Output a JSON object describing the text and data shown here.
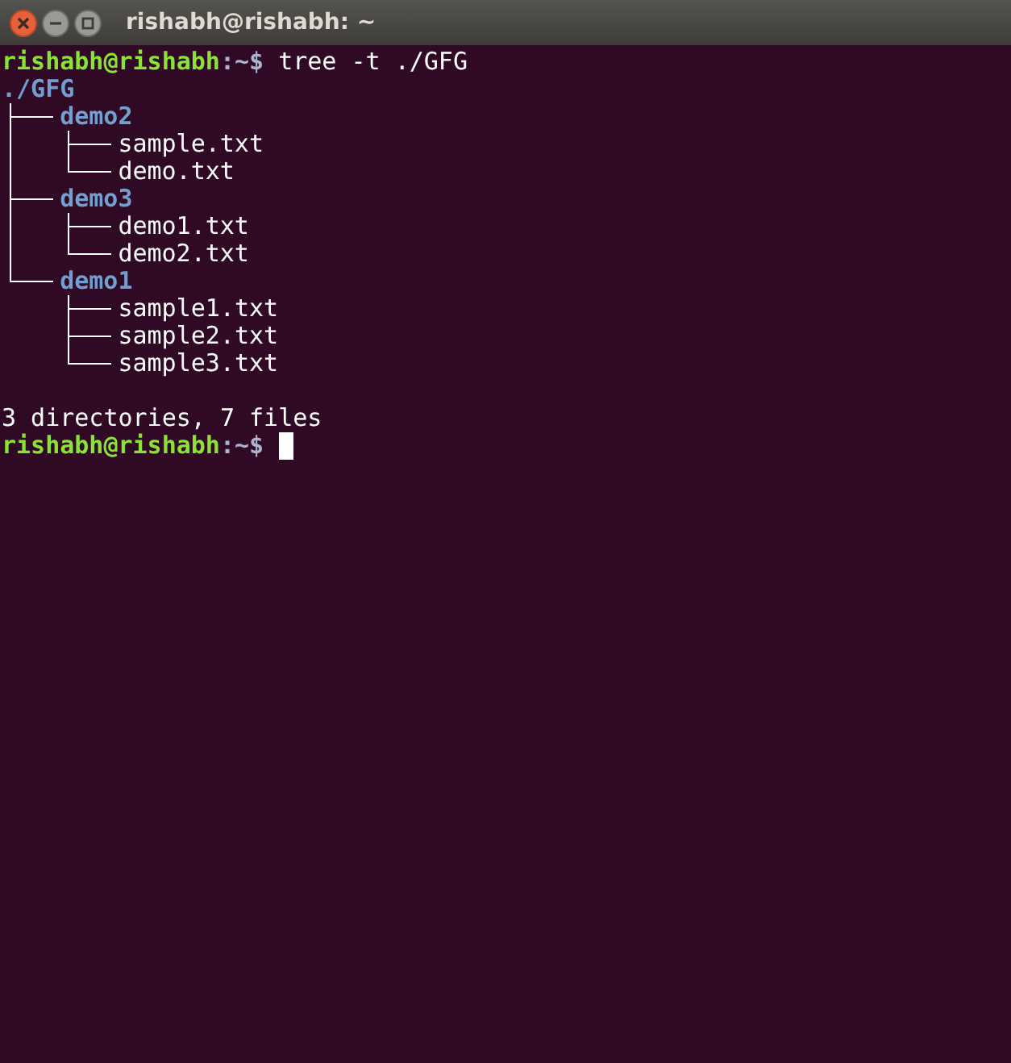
{
  "window": {
    "title": "rishabh@rishabh: ~"
  },
  "terminal": {
    "lines": [
      {
        "kind": "prompt",
        "user": "rishabh@rishabh",
        "path": ":~$",
        "command": "tree -t ./GFG"
      },
      {
        "kind": "tree",
        "root": {
          "name": "./GFG",
          "kind": "dir",
          "children": [
            {
              "name": "demo2",
              "kind": "dir",
              "children": [
                {
                  "name": "sample.txt",
                  "kind": "file"
                },
                {
                  "name": "demo.txt",
                  "kind": "file"
                }
              ]
            },
            {
              "name": "demo3",
              "kind": "dir",
              "children": [
                {
                  "name": "demo1.txt",
                  "kind": "file"
                },
                {
                  "name": "demo2.txt",
                  "kind": "file"
                }
              ]
            },
            {
              "name": "demo1",
              "kind": "dir",
              "children": [
                {
                  "name": "sample1.txt",
                  "kind": "file"
                },
                {
                  "name": "sample2.txt",
                  "kind": "file"
                },
                {
                  "name": "sample3.txt",
                  "kind": "file"
                }
              ]
            }
          ]
        }
      },
      {
        "kind": "summary",
        "text": "3 directories, 7 files"
      },
      {
        "kind": "prompt",
        "user": "rishabh@rishabh",
        "path": ":~$",
        "cursor": true
      }
    ]
  }
}
